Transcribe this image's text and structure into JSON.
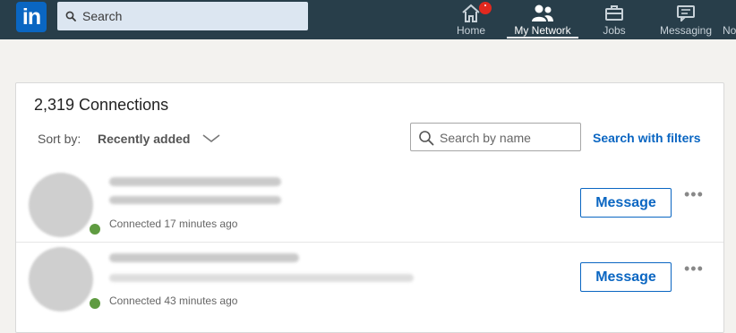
{
  "nav": {
    "logo_text": "in",
    "search_placeholder": "Search",
    "items": [
      {
        "label": "Home",
        "icon": "home-icon"
      },
      {
        "label": "My Network",
        "icon": "network-icon"
      },
      {
        "label": "Jobs",
        "icon": "briefcase-icon"
      },
      {
        "label": "Messaging",
        "icon": "messaging-icon"
      },
      {
        "label": "No"
      }
    ],
    "active": "My Network",
    "badge_color": "#e2291f"
  },
  "connections": {
    "title": "2,319 Connections",
    "sort_label": "Sort by:",
    "sort_value": "Recently added",
    "search_placeholder": "Search by name",
    "filters_link": "Search with filters",
    "rows": [
      {
        "connected": "Connected 17 minutes ago",
        "action": "Message"
      },
      {
        "connected": "Connected 43 minutes ago",
        "action": "Message"
      }
    ]
  },
  "colors": {
    "nav_bg": "#283e4a",
    "accent": "#0a66c2",
    "presence": "#5f9b41"
  }
}
